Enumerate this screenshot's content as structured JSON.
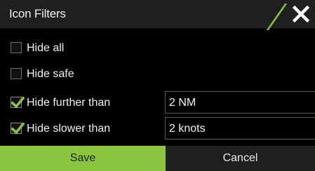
{
  "dialog": {
    "title": "Icon Filters",
    "accent_color": "#8cc63f",
    "close_icon": "close-icon"
  },
  "filters": [
    {
      "label": "Hide all",
      "checked": false
    },
    {
      "label": "Hide safe",
      "checked": false
    },
    {
      "label": "Hide further than",
      "checked": true,
      "value": "2 NM"
    },
    {
      "label": "Hide slower than",
      "checked": true,
      "value": "2 knots"
    }
  ],
  "buttons": {
    "save": "Save",
    "cancel": "Cancel"
  }
}
